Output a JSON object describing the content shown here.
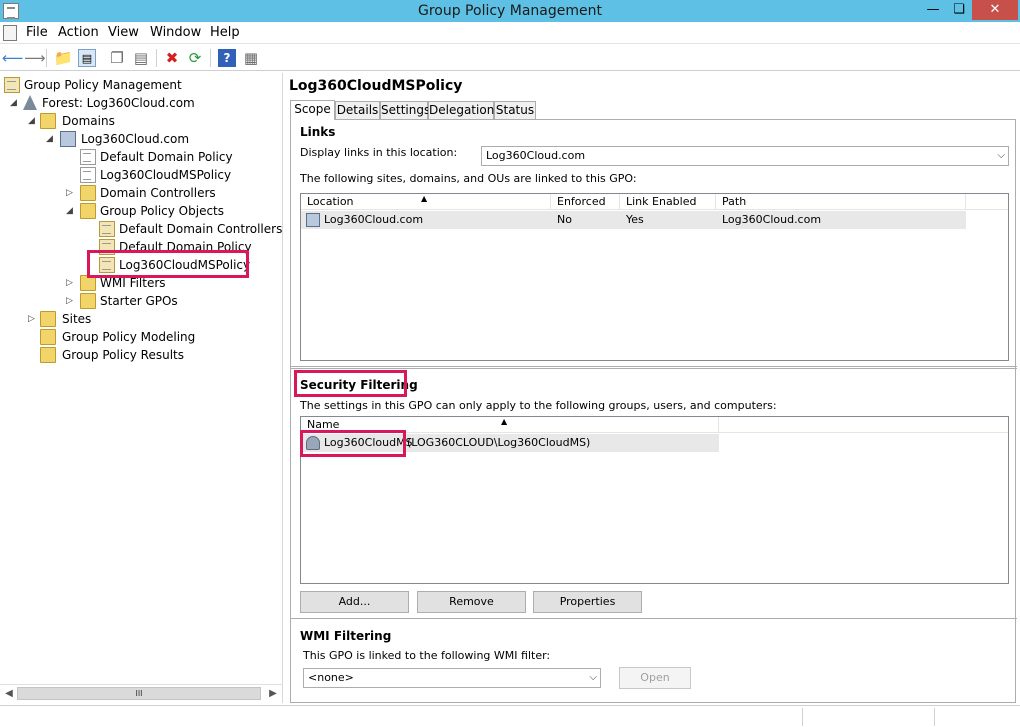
{
  "window": {
    "title": "Group Policy Management"
  },
  "menubar": {
    "items": [
      "File",
      "Action",
      "View",
      "Window",
      "Help"
    ]
  },
  "toolbar": {
    "icons": [
      "back-arrow-icon",
      "forward-arrow-icon",
      "up-folder-icon",
      "show-hide-tree-icon",
      "copy-icon",
      "paste-icon",
      "delete-icon",
      "refresh-icon",
      "help-icon",
      "properties-icon"
    ]
  },
  "tree": {
    "items": [
      {
        "label": "Group Policy Management",
        "icon": "gpm-icon"
      },
      {
        "label": "Forest: Log360Cloud.com",
        "icon": "forest-icon"
      },
      {
        "label": "Domains",
        "icon": "folder-icon"
      },
      {
        "label": "Log360Cloud.com",
        "icon": "domain-icon"
      },
      {
        "label": "Default Domain Policy",
        "icon": "gpo-link-icon"
      },
      {
        "label": "Log360CloudMSPolicy",
        "icon": "gpo-link-icon"
      },
      {
        "label": "Domain Controllers",
        "icon": "ou-folder-icon"
      },
      {
        "label": "Group Policy Objects",
        "icon": "folder-icon"
      },
      {
        "label": "Default Domain Controllers Po",
        "icon": "gpo-icon"
      },
      {
        "label": "Default Domain Policy",
        "icon": "gpo-icon"
      },
      {
        "label": "Log360CloudMSPolicy",
        "icon": "gpo-icon"
      },
      {
        "label": "WMI Filters",
        "icon": "folder-icon"
      },
      {
        "label": "Starter GPOs",
        "icon": "folder-icon"
      },
      {
        "label": "Sites",
        "icon": "sites-icon"
      },
      {
        "label": "Group Policy Modeling",
        "icon": "modeling-icon"
      },
      {
        "label": "Group Policy Results",
        "icon": "results-icon"
      }
    ],
    "scroll_thumb": "III"
  },
  "details": {
    "title": "Log360CloudMSPolicy",
    "tabs": [
      "Scope",
      "Details",
      "Settings",
      "Delegation",
      "Status"
    ],
    "active_tab": "Scope",
    "links": {
      "heading": "Links",
      "location_label": "Display links in this location:",
      "location_value": "Log360Cloud.com",
      "description": "The following sites, domains, and OUs are linked to this GPO:",
      "columns": [
        "Location",
        "Enforced",
        "Link Enabled",
        "Path"
      ],
      "rows": [
        [
          "Log360Cloud.com",
          "No",
          "Yes",
          "Log360Cloud.com"
        ]
      ]
    },
    "security": {
      "heading": "Security Filtering",
      "description": "The settings in this GPO can only apply to the following groups, users, and computers:",
      "columns": [
        "Name"
      ],
      "row_name": "Log360CloudMS",
      "row_account": "(LOG360CLOUD\\Log360CloudMS)",
      "buttons": {
        "add": "Add...",
        "remove": "Remove",
        "properties": "Properties"
      }
    },
    "wmi": {
      "heading": "WMI Filtering",
      "description": "This GPO is linked to the following WMI filter:",
      "value": "<none>",
      "open_button": "Open"
    }
  }
}
